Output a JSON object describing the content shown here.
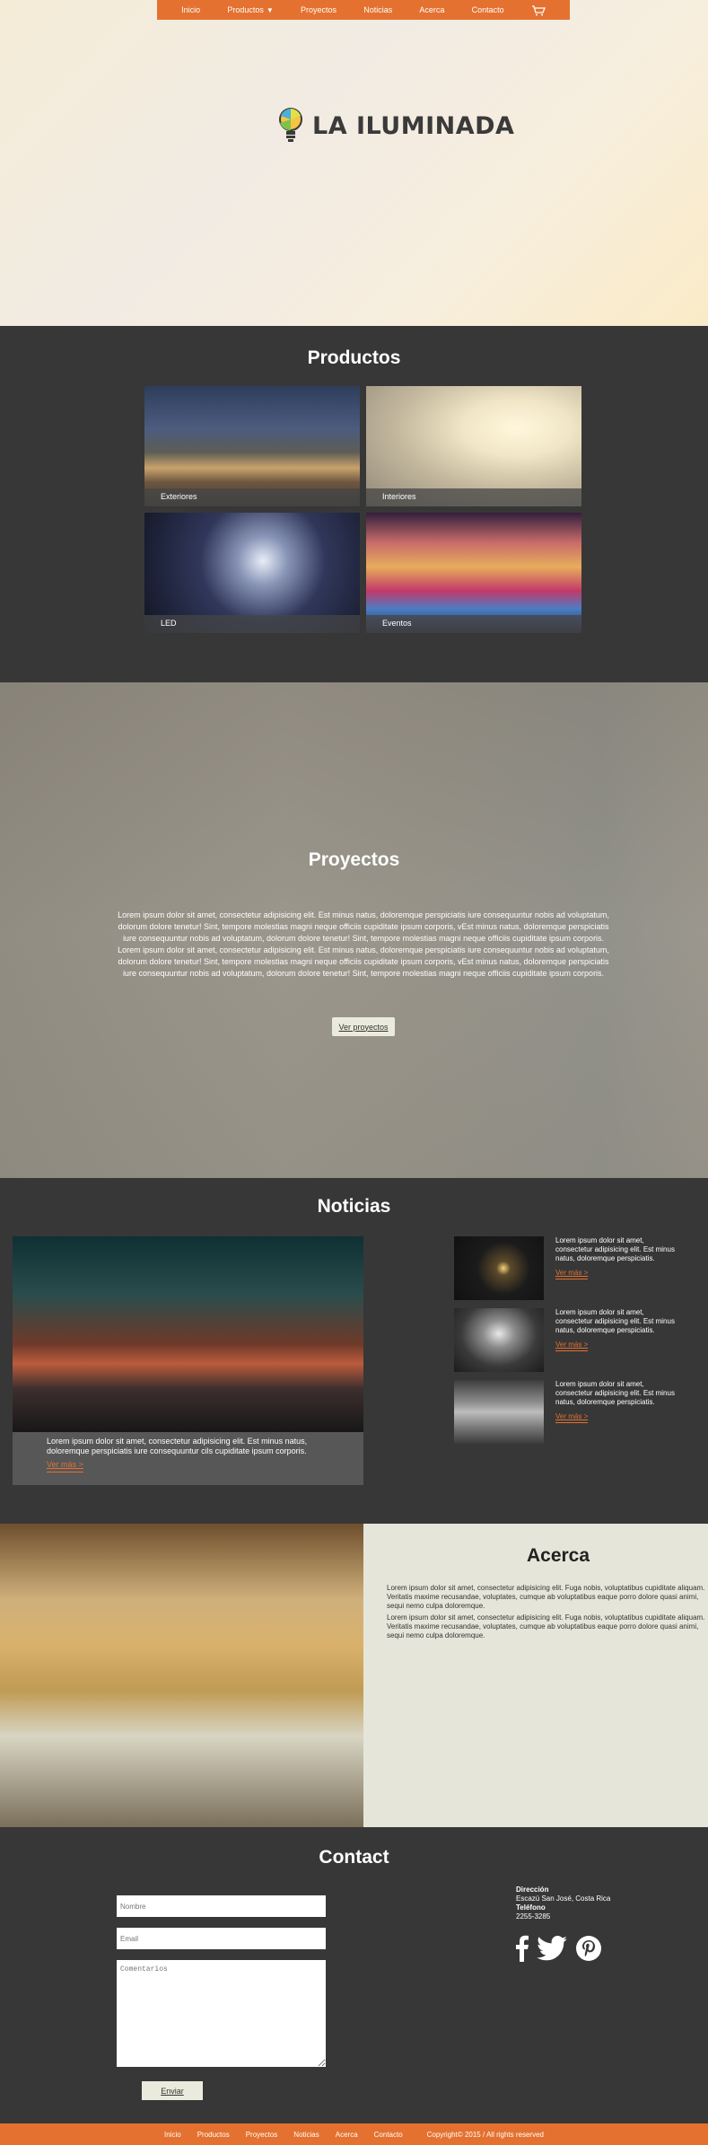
{
  "nav": {
    "items": [
      "Inicio",
      "Productos",
      "Proyectos",
      "Noticias",
      "Acerca",
      "Contacto"
    ],
    "cart_icon": "cart-icon",
    "dropdown_icon": "caret-down-icon"
  },
  "brand": {
    "name": "LA ILUMINADA",
    "icon": "lightbulb-icon"
  },
  "productos": {
    "title": "Productos",
    "items": [
      "Exteriores",
      "Interiores",
      "LED",
      "Eventos"
    ]
  },
  "proyectos": {
    "title": "Proyectos",
    "text": "Lorem ipsum dolor sit amet, consectetur adipisicing elit. Est minus natus, doloremque perspiciatis iure consequuntur nobis ad voluptatum, dolorum dolore tenetur! Sint, tempore molestias magni neque officiis cupiditate ipsum corporis, vEst minus natus, doloremque perspiciatis iure consequuntur nobis ad voluptatum, dolorum dolore tenetur! Sint, tempore molestias magni neque officiis cupiditate ipsum corporis. Lorem ipsum dolor sit amet, consectetur adipisicing elit. Est minus natus, doloremque perspiciatis iure consequuntur nobis ad voluptatum, dolorum dolore tenetur! Sint, tempore molestias magni neque officiis cupiditate ipsum corporis, vEst minus natus, doloremque perspiciatis iure consequuntur nobis ad voluptatum, dolorum dolore tenetur! Sint, tempore molestias magni neque officiis cupiditate ipsum corporis.",
    "button": "Ver proyectos"
  },
  "noticias": {
    "title": "Noticias",
    "main": {
      "text": "Lorem ipsum dolor sit amet, consectetur adipisicing elit. Est minus natus, doloremque perspiciatis iure consequuntur cils cupiditate ipsum corporis.",
      "more": "Ver más >"
    },
    "side": [
      {
        "text": "Lorem ipsum dolor sit amet, consectetur adipisicing elit. Est minus natus, doloremque perspiciatis.",
        "more": "Ver más >"
      },
      {
        "text": "Lorem ipsum dolor sit amet, consectetur adipisicing elit. Est minus natus, doloremque perspiciatis.",
        "more": "Ver más >"
      },
      {
        "text": "Lorem ipsum dolor sit amet, consectetur adipisicing elit. Est minus natus, doloremque perspiciatis.",
        "more": "Ver más >"
      }
    ]
  },
  "acerca": {
    "title": "Acerca",
    "p1": "Lorem ipsum dolor sit amet, consectetur adipisicing elit. Fuga nobis, voluptatibus cupiditate aliquam. Veritatis maxime recusandae, voluptates, cumque ab voluptatibus eaque porro dolore quasi animi, sequi nemo culpa doloremque.",
    "p2": "Lorem ipsum dolor sit amet, consectetur adipisicing elit. Fuga nobis, voluptatibus cupiditate aliquam. Veritatis maxime recusandae, voluptates, cumque ab voluptatibus eaque porro dolore quasi animi, sequi nemo culpa doloremque."
  },
  "contact": {
    "title": "Contact",
    "name_placeholder": "Nombre",
    "email_placeholder": "Email",
    "comments_placeholder": "Comentarios",
    "button": "Enviar",
    "direccion_label": "Dirección",
    "direccion": "Escazú San José, Costa Rica",
    "telefono_label": "Teléfono",
    "telefono": "2255-3285",
    "social_icons": [
      "facebook-icon",
      "twitter-icon",
      "pinterest-icon"
    ]
  },
  "footer": {
    "items": [
      "Inicio",
      "Productos",
      "Proyectos",
      "Noticias",
      "Acerca",
      "Contacto"
    ],
    "copyright": "Copyright© 2015 / All rights reserved"
  },
  "colors": {
    "accent": "#e4712f",
    "dark": "#373737",
    "light": "#e6e5d9"
  }
}
